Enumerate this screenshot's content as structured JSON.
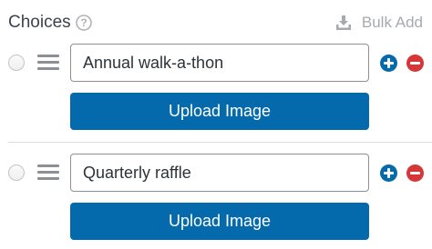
{
  "header": {
    "title": "Choices",
    "help_icon": "question-circle-icon",
    "bulk_add_label": "Bulk Add",
    "bulk_add_icon": "download-icon"
  },
  "choices": [
    {
      "value": "Annual walk-a-thon",
      "upload_label": "Upload Image"
    },
    {
      "value": "Quarterly raffle",
      "upload_label": "Upload Image"
    }
  ],
  "icons": {
    "drag": "drag-handle-icon",
    "add": "plus-circle-icon",
    "remove": "minus-circle-icon"
  },
  "colors": {
    "accent": "#056aab",
    "danger": "#d63638",
    "muted": "#a7aaad"
  }
}
